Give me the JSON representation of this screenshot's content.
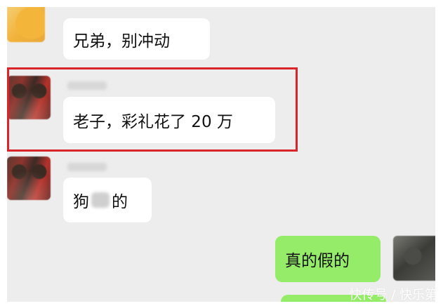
{
  "messages": [
    {
      "text": "兄弟，别冲动",
      "direction": "incoming",
      "avatar": "yellow-avatar"
    },
    {
      "text": "老子，彩礼花了 20 万",
      "direction": "incoming",
      "avatar": "red-avatar",
      "highlighted": true
    },
    {
      "text_before": "狗",
      "text_after": "的",
      "direction": "incoming",
      "avatar": "red-avatar"
    },
    {
      "text": "真的假的",
      "direction": "outgoing",
      "avatar": "dark-avatar"
    }
  ],
  "watermark": "快传号 / 快乐第",
  "colors": {
    "chat_background": "#ededed",
    "incoming_bubble": "#ffffff",
    "outgoing_bubble": "#95ec69",
    "highlight_border": "#d9242a"
  }
}
